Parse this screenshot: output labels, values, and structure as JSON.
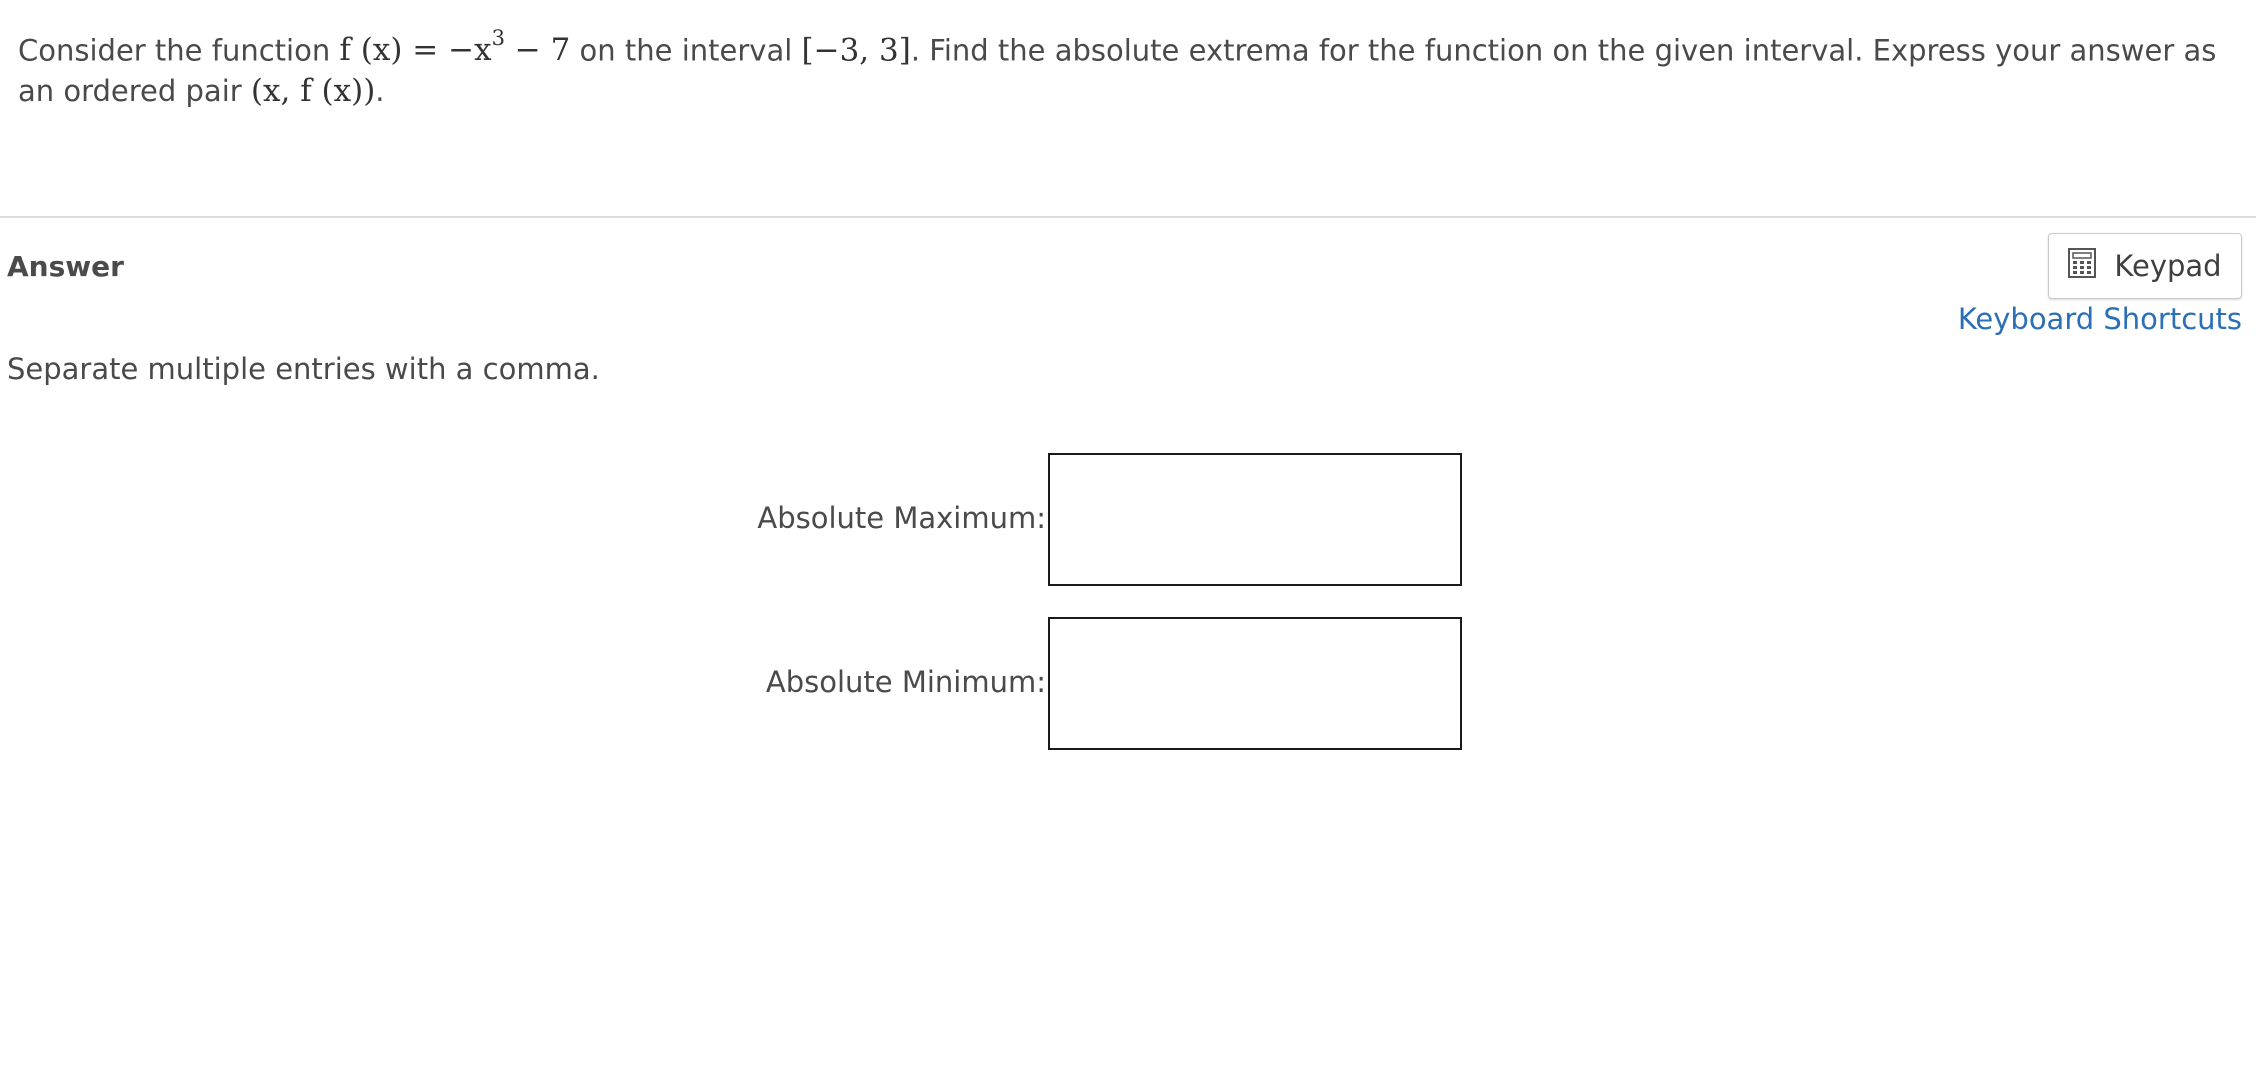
{
  "question": {
    "intro": "Consider the function ",
    "fx": "f (x)",
    "eq": " = −x",
    "exp": "3",
    "rest_expr": " − 7",
    "mid_text": " on the interval ",
    "interval": "[−3, 3]",
    "tail_text": ". Find the absolute extrema for the function on the given interval. Express your answer as an ordered pair ",
    "pair": "(x, f (x))",
    "period": "."
  },
  "answer": {
    "heading": "Answer",
    "keypad_label": "Keypad",
    "keypad_icon": "calculator-icon",
    "shortcuts_label": "Keyboard Shortcuts",
    "instructions": "Separate multiple entries with a comma.",
    "fields": [
      {
        "label": "Absolute Maximum:",
        "value": ""
      },
      {
        "label": "Absolute Minimum:",
        "value": ""
      }
    ]
  },
  "colors": {
    "link": "#2b6fb6",
    "text": "#4a4a4a",
    "divider": "#dcdcdc",
    "input_border": "#1a1a1a"
  }
}
